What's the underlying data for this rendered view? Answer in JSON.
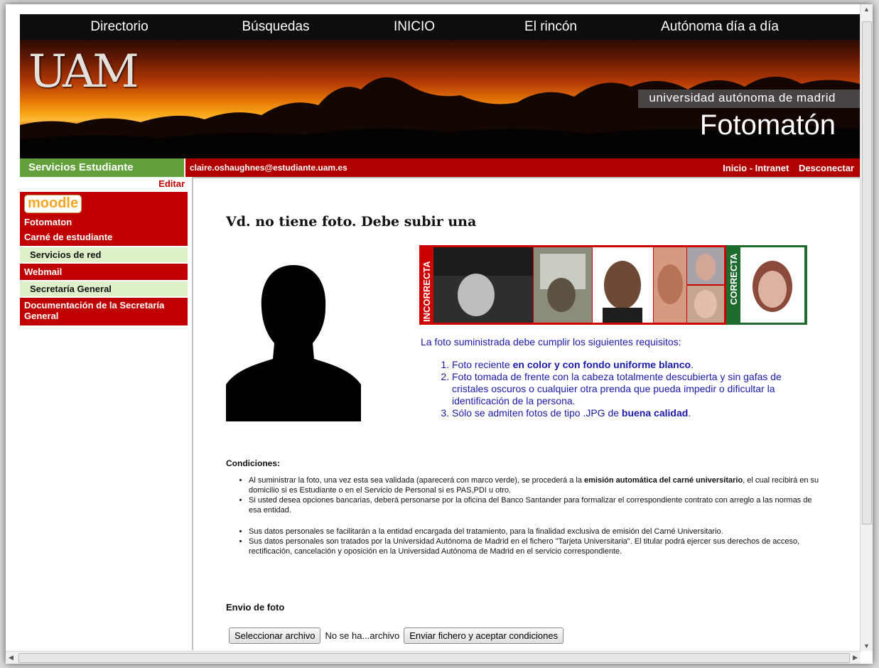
{
  "nav": [
    "Directorio",
    "Búsquedas",
    "INICIO",
    "El rincón",
    "Autónoma día a día"
  ],
  "banner": {
    "logo": "UAM",
    "university": "universidad autónoma de madrid",
    "app_title": "Fotomatón"
  },
  "user_bar": {
    "section": "Servicios Estudiante",
    "email": "claire.oshaughnes@estudiante.uam.es",
    "inicio": "Inicio - Intranet",
    "logout": "Desconectar"
  },
  "sidebar": {
    "edit": "Editar",
    "moodle": "moodle",
    "items": [
      {
        "label": "Fotomaton"
      },
      {
        "label": "Carné de estudiante"
      },
      {
        "label": "Servicios de red"
      },
      {
        "label": "Webmail"
      },
      {
        "label": "Secretaría General"
      },
      {
        "label": "Documentación de la Secretaría General"
      }
    ]
  },
  "main": {
    "headline": "Vd. no tiene foto. Debe subir una",
    "examples": {
      "incorrect_label": "INCORRECTA",
      "correct_label": "CORRECTA"
    },
    "requirements_intro": "La foto suministrada debe cumplir los siguientes requisitos:",
    "req1_pre": "Foto reciente ",
    "req1_bold": "en color y con fondo uniforme blanco",
    "req1_post": ".",
    "req2": "Foto tomada de frente con la cabeza totalmente descubierta y sin gafas de cristales oscuros o cualquier otra prenda que pueda impedir o dificultar la identificación de la persona.",
    "req3_pre": "Sólo se admiten fotos de tipo .JPG de ",
    "req3_bold": "buena calidad",
    "req3_post": ".",
    "conditions_title": "Condiciones",
    "cond1_pre": "Al suministrar la foto, una vez esta sea validada (aparecerá con marco verde), se procederá a la ",
    "cond1_bold": "emisión automática del carné universitario",
    "cond1_post": ", el cual recibirá en su domicilio si es Estudiante o en el Servicio de Personal si es PAS,PDI u otro.",
    "cond2": "Si usted desea opciones bancarias, deberá personarse por la oficina del Banco Santander para formalizar el correspondiente contrato con arreglo a las normas de esa entidad.",
    "cond3": "Sus datos personales se facilitarán a la entidad encargada del tratamiento, para la finalidad exclusiva de emisión del Carné Universitario.",
    "cond4": "Sus datos personales son tratados por la Universidad Autónoma de Madrid en el fichero \"Tarjeta Universitaria\". El titular podrá ejercer sus derechos de acceso, rectificación, cancelación y oposición en la Universidad Autónoma de Madrid en el servicio correspondiente.",
    "upload_title": "Envio de foto",
    "select_file": "Seleccionar archivo",
    "no_file": "No se ha...archivo",
    "submit": "Enviar fichero y aceptar condiciones"
  }
}
